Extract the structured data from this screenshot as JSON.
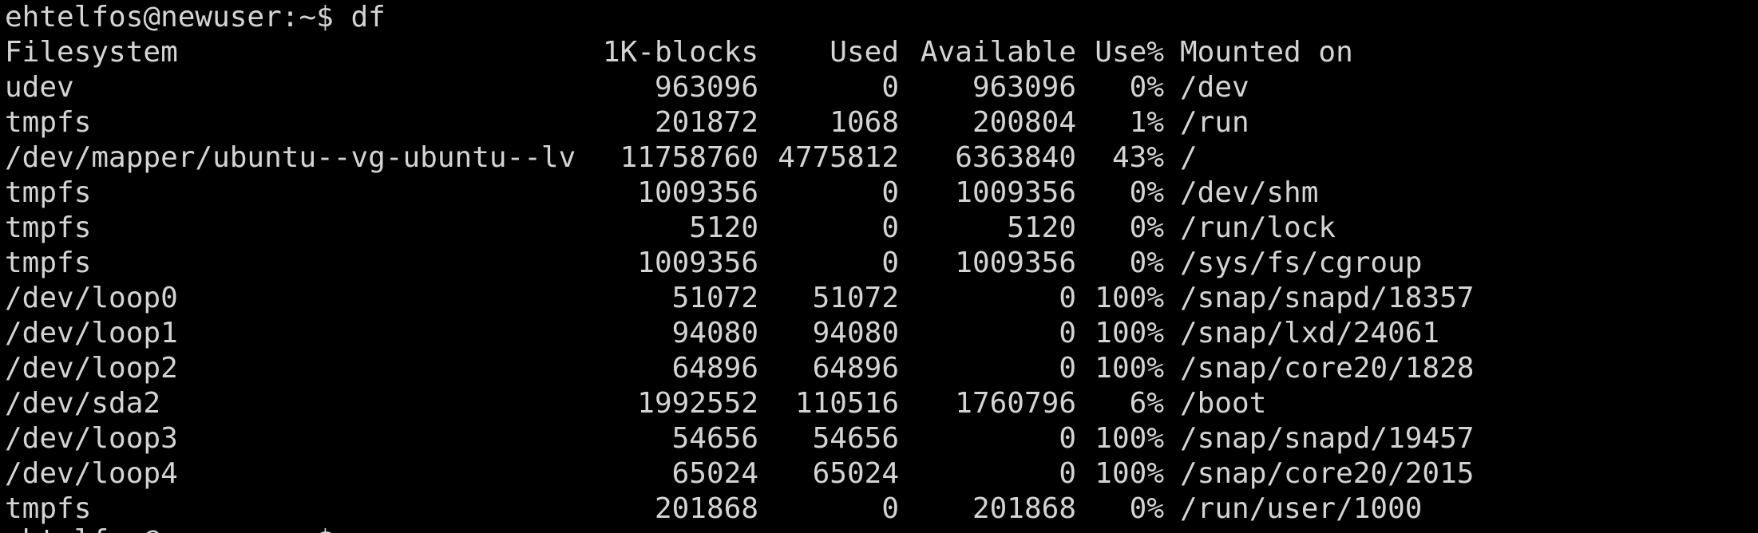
{
  "prompt": "ehtelfos@newuser:~$ df",
  "partial_prompt": "ehtelfos@newuser:~$",
  "colors": {
    "background": "#000000",
    "text": "#d4d4d4"
  },
  "header": {
    "filesystem": "Filesystem",
    "blocks": "1K-blocks",
    "used": "Used",
    "available": "Available",
    "use_pct": "Use%",
    "mounted": "Mounted on"
  },
  "rows": [
    {
      "filesystem": "udev",
      "blocks": "963096",
      "used": "0",
      "available": "963096",
      "use_pct": "0%",
      "mounted": "/dev"
    },
    {
      "filesystem": "tmpfs",
      "blocks": "201872",
      "used": "1068",
      "available": "200804",
      "use_pct": "1%",
      "mounted": "/run"
    },
    {
      "filesystem": "/dev/mapper/ubuntu--vg-ubuntu--lv",
      "blocks": "11758760",
      "used": "4775812",
      "available": "6363840",
      "use_pct": "43%",
      "mounted": "/"
    },
    {
      "filesystem": "tmpfs",
      "blocks": "1009356",
      "used": "0",
      "available": "1009356",
      "use_pct": "0%",
      "mounted": "/dev/shm"
    },
    {
      "filesystem": "tmpfs",
      "blocks": "5120",
      "used": "0",
      "available": "5120",
      "use_pct": "0%",
      "mounted": "/run/lock"
    },
    {
      "filesystem": "tmpfs",
      "blocks": "1009356",
      "used": "0",
      "available": "1009356",
      "use_pct": "0%",
      "mounted": "/sys/fs/cgroup"
    },
    {
      "filesystem": "/dev/loop0",
      "blocks": "51072",
      "used": "51072",
      "available": "0",
      "use_pct": "100%",
      "mounted": "/snap/snapd/18357"
    },
    {
      "filesystem": "/dev/loop1",
      "blocks": "94080",
      "used": "94080",
      "available": "0",
      "use_pct": "100%",
      "mounted": "/snap/lxd/24061"
    },
    {
      "filesystem": "/dev/loop2",
      "blocks": "64896",
      "used": "64896",
      "available": "0",
      "use_pct": "100%",
      "mounted": "/snap/core20/1828"
    },
    {
      "filesystem": "/dev/sda2",
      "blocks": "1992552",
      "used": "110516",
      "available": "1760796",
      "use_pct": "6%",
      "mounted": "/boot"
    },
    {
      "filesystem": "/dev/loop3",
      "blocks": "54656",
      "used": "54656",
      "available": "0",
      "use_pct": "100%",
      "mounted": "/snap/snapd/19457"
    },
    {
      "filesystem": "/dev/loop4",
      "blocks": "65024",
      "used": "65024",
      "available": "0",
      "use_pct": "100%",
      "mounted": "/snap/core20/2015"
    },
    {
      "filesystem": "tmpfs",
      "blocks": "201868",
      "used": "0",
      "available": "201868",
      "use_pct": "0%",
      "mounted": "/run/user/1000"
    }
  ]
}
